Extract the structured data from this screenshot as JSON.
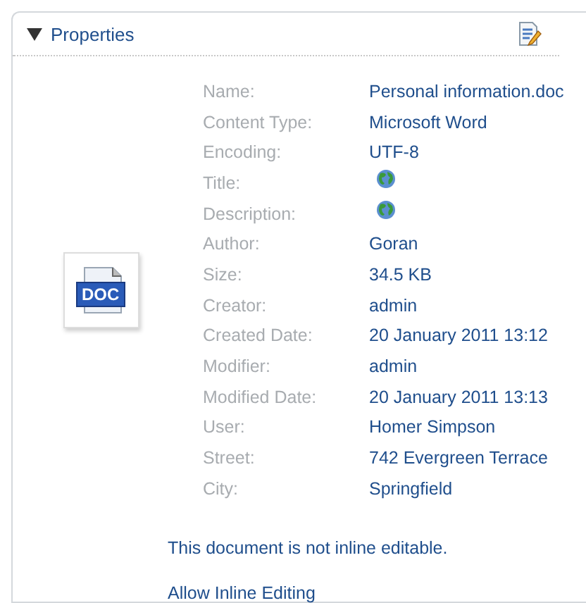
{
  "panel": {
    "title": "Properties",
    "expanded": true
  },
  "properties": [
    {
      "label": "Name:",
      "kind": "text",
      "value": "Personal information.doc"
    },
    {
      "label": "Content Type:",
      "kind": "text",
      "value": "Microsoft Word"
    },
    {
      "label": "Encoding:",
      "kind": "text",
      "value": "UTF-8"
    },
    {
      "label": "Title:",
      "kind": "globe"
    },
    {
      "label": "Description:",
      "kind": "globe"
    },
    {
      "label": "Author:",
      "kind": "text",
      "value": "Goran"
    },
    {
      "label": "Size:",
      "kind": "text",
      "value": "34.5 KB"
    },
    {
      "label": "Creator:",
      "kind": "text",
      "value": "admin"
    },
    {
      "label": "Created Date:",
      "kind": "text",
      "value": "20 January 2011 13:12"
    },
    {
      "label": "Modifier:",
      "kind": "text",
      "value": "admin"
    },
    {
      "label": "Modified Date:",
      "kind": "text",
      "value": "20 January 2011 13:13"
    },
    {
      "label": "User:",
      "kind": "text",
      "value": "Homer Simpson"
    },
    {
      "label": "Street:",
      "kind": "text",
      "value": "742 Evergreen Terrace"
    },
    {
      "label": "City:",
      "kind": "text",
      "value": "Springfield"
    }
  ],
  "file_badge": "DOC",
  "message": "This document is not inline editable.",
  "link": "Allow Inline Editing"
}
